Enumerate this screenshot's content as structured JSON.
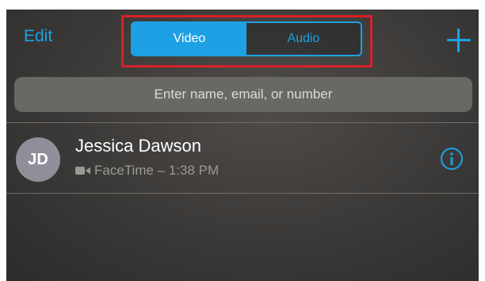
{
  "header": {
    "edit_label": "Edit",
    "tabs": [
      {
        "label": "Video",
        "selected": true
      },
      {
        "label": "Audio",
        "selected": false
      }
    ],
    "add_icon": "plus-icon"
  },
  "search": {
    "placeholder": "Enter name, email, or number"
  },
  "recents": [
    {
      "initials": "JD",
      "name": "Jessica Dawson",
      "call_type_icon": "video-camera-icon",
      "detail": "FaceTime – 1:38 PM",
      "info_icon": "info-icon"
    }
  ],
  "colors": {
    "accent": "#1ea1e4",
    "highlight_box": "#d9202a",
    "avatar": "#8e8f99"
  }
}
